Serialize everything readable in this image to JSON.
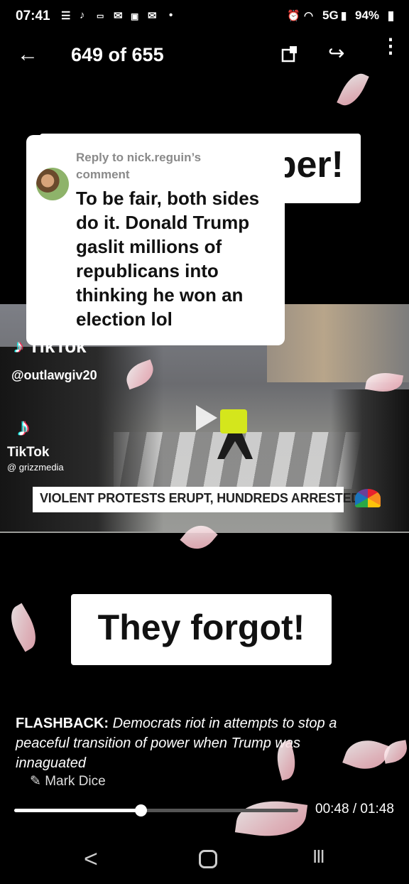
{
  "status_bar": {
    "time": "07:41",
    "left_icons": [
      "menu-icon",
      "tiktok-icon",
      "ring-icon",
      "mail-icon",
      "yahoo-icon",
      "mail-icon",
      "dot-icon"
    ],
    "right_text": "5G",
    "battery": "94%"
  },
  "top_bar": {
    "counter": "649 of 655",
    "back_icon": "arrow-left-icon",
    "copy_icon": "copy-icon",
    "share_icon": "share-icon",
    "more_icon": "more-vertical-icon"
  },
  "video": {
    "banner_top_text": "per!",
    "comment": {
      "reply_label": "Reply to nick.reguin’s comment",
      "text": "To be fair, both sides do it. Donald Trump gaslit millions of republicans into thinking he won an election lol"
    },
    "tiktok_brand": "TikTok",
    "tiktok_handle_1": "@outlawgiv20",
    "tiktok_brand_2": "TikTok",
    "tiktok_handle_2": "@ grizzmedia",
    "headline": "VIOLENT PROTESTS ERUPT, HUNDREDS ARRESTED",
    "banner_bottom_text": "They forgot!",
    "caption_flash": "FLASHBACK:",
    "caption_body": " Democrats riot in attempts to stop a peaceful transition of power when Trump was innaguated",
    "author": "Mark Dice"
  },
  "playback": {
    "position_fraction": 0.4444,
    "time_display": "00:48 / 01:48"
  },
  "nav_bar": {
    "back": "<",
    "recent": "III"
  },
  "colors": {
    "background": "#000000",
    "card": "#ffffff",
    "officer_vest": "#d4e61c",
    "petal": "#f6c7cf"
  }
}
